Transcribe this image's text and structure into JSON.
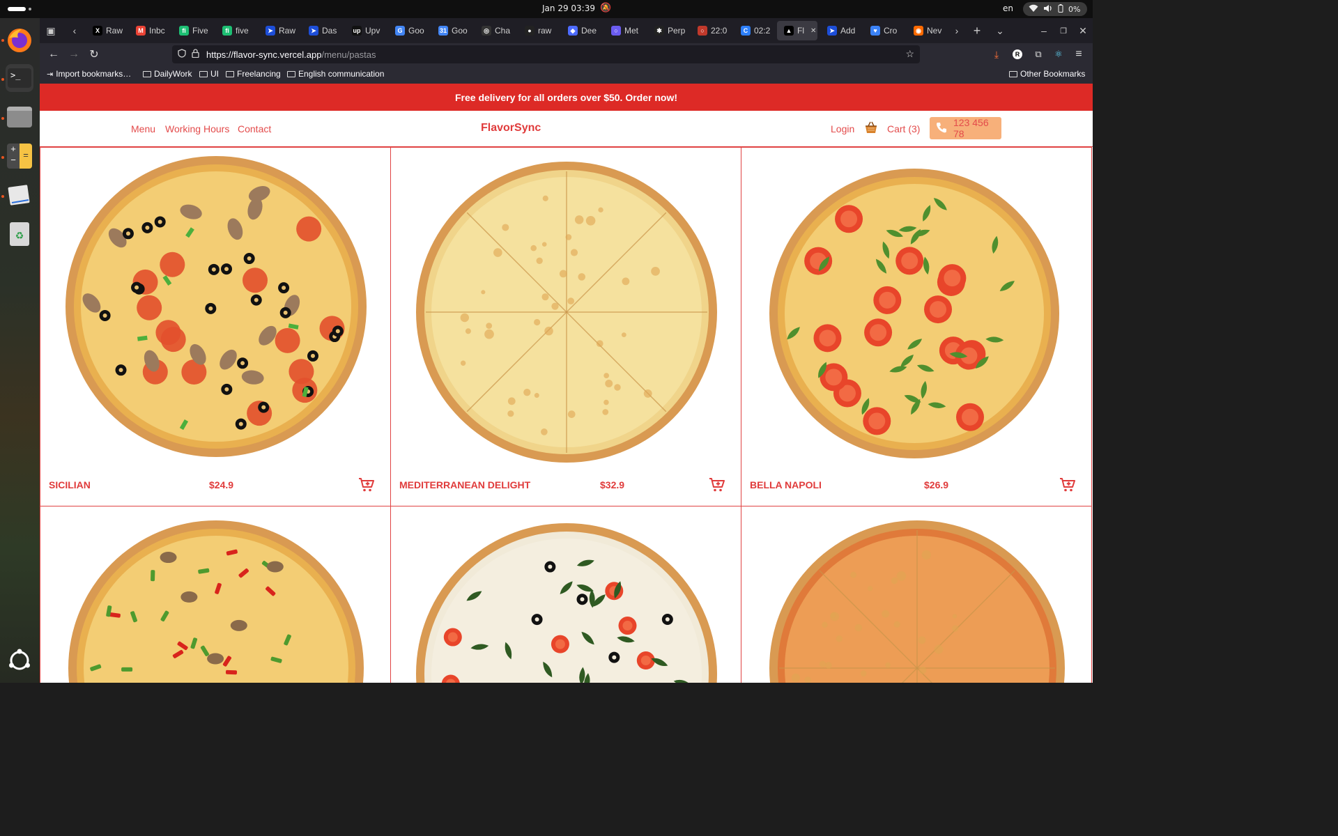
{
  "system": {
    "clock": "Jan 29  03:39",
    "language": "en",
    "battery": "0%"
  },
  "browser": {
    "tabs": [
      {
        "label": "Raw",
        "icon": "x-icon",
        "color": "#000000",
        "glyph": "X"
      },
      {
        "label": "Inbc",
        "icon": "gmail-icon",
        "color": "#ea4335",
        "glyph": "M"
      },
      {
        "label": "Five",
        "icon": "fiverr-icon",
        "color": "#1dbf73",
        "glyph": "fi"
      },
      {
        "label": "five",
        "icon": "fiverr-icon",
        "color": "#1dbf73",
        "glyph": "fi"
      },
      {
        "label": "Raw",
        "icon": "arrow-app-icon",
        "color": "#1d4ed8",
        "glyph": "➤"
      },
      {
        "label": "Das",
        "icon": "arrow-app-icon",
        "color": "#1d4ed8",
        "glyph": "➤"
      },
      {
        "label": "Upv",
        "icon": "upwork-icon",
        "color": "#111111",
        "glyph": "up"
      },
      {
        "label": "Goo",
        "icon": "google-translate-icon",
        "color": "#4285f4",
        "glyph": "G"
      },
      {
        "label": "Goo",
        "icon": "google-calendar-icon",
        "color": "#4285f4",
        "glyph": "31"
      },
      {
        "label": "Cha",
        "icon": "chatgpt-icon",
        "color": "#333333",
        "glyph": "◎"
      },
      {
        "label": "raw",
        "icon": "github-icon",
        "color": "#222222",
        "glyph": "●"
      },
      {
        "label": "Dee",
        "icon": "deepseek-icon",
        "color": "#4d6bfe",
        "glyph": "◆"
      },
      {
        "label": "Met",
        "icon": "meta-icon",
        "color": "#6b5cf0",
        "glyph": "○"
      },
      {
        "label": "Perp",
        "icon": "perplexity-icon",
        "color": "#222222",
        "glyph": "✱"
      },
      {
        "label": "22:0",
        "icon": "ring-icon",
        "color": "#c0392b",
        "glyph": "○"
      },
      {
        "label": "02:2",
        "icon": "app-icon",
        "color": "#2d7ff9",
        "glyph": "C"
      },
      {
        "label": "Fl",
        "icon": "vercel-icon",
        "color": "#000000",
        "glyph": "▲",
        "active": true
      },
      {
        "label": "Add",
        "icon": "arrow-app-icon",
        "color": "#1d4ed8",
        "glyph": "➤"
      },
      {
        "label": "Cro",
        "icon": "heart-icon",
        "color": "#3b82f6",
        "glyph": "♥"
      },
      {
        "label": "Nev",
        "icon": "firefox-icon",
        "color": "#ff6a00",
        "glyph": "◉"
      }
    ],
    "url_host": "https://flavor-sync.vercel.app",
    "url_path": "/menu/pastas",
    "bookmarks": [
      {
        "label": "Import bookmarks…",
        "icon": "import-icon"
      },
      {
        "label": "DailyWork",
        "icon": "folder-icon"
      },
      {
        "label": "UI",
        "icon": "folder-icon"
      },
      {
        "label": "Freelancing",
        "icon": "folder-icon"
      },
      {
        "label": "English communication",
        "icon": "folder-icon"
      }
    ],
    "other_bookmarks": "Other Bookmarks"
  },
  "site": {
    "promo": "Free delivery for all orders over $50. Order now!",
    "nav": [
      "Menu",
      "Working Hours",
      "Contact"
    ],
    "logo": "FlavorSync",
    "login": "Login",
    "cart": "Cart (3)",
    "phone": "123 456 78",
    "accent": "#e03b3b",
    "products": [
      {
        "name": "Sicilian",
        "price": "$24.9",
        "style": "loaded"
      },
      {
        "name": "Mediterranean Delight",
        "price": "$32.9",
        "style": "cheese"
      },
      {
        "name": "Bella Napoli",
        "price": "$26.9",
        "style": "arugula"
      },
      {
        "name": "",
        "price": "",
        "style": "peppers"
      },
      {
        "name": "",
        "price": "",
        "style": "spinach"
      },
      {
        "name": "",
        "price": "",
        "style": "margherita"
      }
    ]
  }
}
